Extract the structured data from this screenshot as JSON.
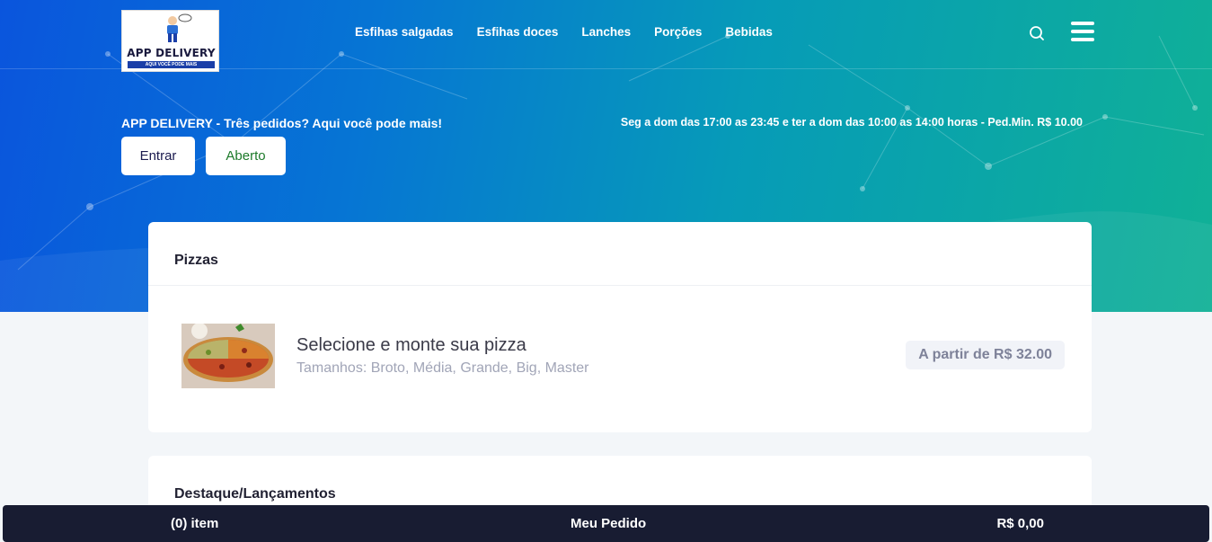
{
  "header": {
    "logo": {
      "brand": "APP DELIVERY",
      "tagline": "AQUI VOCÊ PODE MAIS",
      "icon": "delivery-mascot-icon"
    },
    "nav": [
      {
        "label": "Esfihas salgadas"
      },
      {
        "label": "Esfihas doces"
      },
      {
        "label": "Lanches"
      },
      {
        "label": "Porções"
      },
      {
        "label": "Bebidas"
      }
    ],
    "search_icon": "search-icon",
    "menu_icon": "hamburger-menu-icon"
  },
  "hero": {
    "tagline": "APP DELIVERY - Três pedidos? Aqui você pode mais!",
    "hours": "Seg a dom das 17:00 as 23:45 e ter a dom das 10:00 as 14:00 horas - Ped.Min. R$ 10.00",
    "login_label": "Entrar",
    "status_label": "Aberto"
  },
  "sections": [
    {
      "title": "Pizzas",
      "products": [
        {
          "name": "Selecione e monte sua pizza",
          "sizes": "Tamanhos: Broto, Média, Grande, Big, Master",
          "price": "A partir de R$ 32.00"
        }
      ]
    },
    {
      "title": "Destaque/Lançamentos",
      "products": []
    }
  ],
  "cart": {
    "items": "(0) item",
    "title": "Meu Pedido",
    "total": "R$ 0,00"
  },
  "colors": {
    "gradient_start": "#0a55dd",
    "gradient_end": "#10b196",
    "footer_bg": "#181c32",
    "status_green": "#1d7a2a"
  }
}
